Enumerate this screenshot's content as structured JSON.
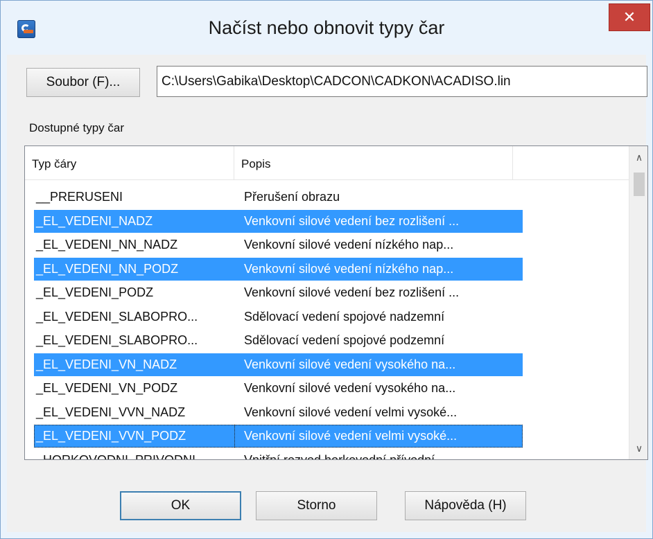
{
  "window": {
    "title": "Načíst nebo obnovit typy čar",
    "close_glyph": "✕",
    "icon": "app-icon"
  },
  "file": {
    "button_label": "Soubor (F)...",
    "path": "C:\\Users\\Gabika\\Desktop\\CADCON\\CADKON\\ACADISO.lin"
  },
  "available_label": "Dostupné typy čar",
  "list": {
    "columns": [
      "Typ čáry",
      "Popis"
    ],
    "rows": [
      {
        "name": "__PRERUSENI",
        "desc": "Přerušení obrazu",
        "selected": false
      },
      {
        "name": "_EL_VEDENI_NADZ",
        "desc": "Venkovní silové vedení bez rozlišení ...",
        "selected": true
      },
      {
        "name": "_EL_VEDENI_NN_NADZ",
        "desc": "Venkovní silové vedení nízkého nap...",
        "selected": false
      },
      {
        "name": "_EL_VEDENI_NN_PODZ",
        "desc": "Venkovní silové vedení nízkého nap...",
        "selected": true
      },
      {
        "name": "_EL_VEDENI_PODZ",
        "desc": "Venkovní silové vedení bez rozlišení ...",
        "selected": false
      },
      {
        "name": "_EL_VEDENI_SLABOPRO...",
        "desc": "Sdělovací vedení spojové nadzemní",
        "selected": false
      },
      {
        "name": "_EL_VEDENI_SLABOPRO...",
        "desc": "Sdělovací vedení spojové podzemní",
        "selected": false
      },
      {
        "name": "_EL_VEDENI_VN_NADZ",
        "desc": "Venkovní silové vedení vysokého na...",
        "selected": true
      },
      {
        "name": "_EL_VEDENI_VN_PODZ",
        "desc": "Venkovní silové vedení vysokého na...",
        "selected": false
      },
      {
        "name": "_EL_VEDENI_VVN_NADZ",
        "desc": "Venkovní silové vedení velmi vysoké...",
        "selected": false
      },
      {
        "name": "_EL_VEDENI_VVN_PODZ",
        "desc": "Venkovní silové vedení velmi vysoké...",
        "selected": true,
        "focused": true
      },
      {
        "name": "_HORKOVODNI_PRIVODNI",
        "desc": "Vnitřní rozvod horkovodní přívodní",
        "selected": false
      }
    ]
  },
  "buttons": {
    "ok": "OK",
    "cancel": "Storno",
    "help": "Nápověda (H)"
  },
  "colors": {
    "selection": "#3399ff",
    "close": "#c7423b",
    "frame": "#eaf3fc"
  }
}
